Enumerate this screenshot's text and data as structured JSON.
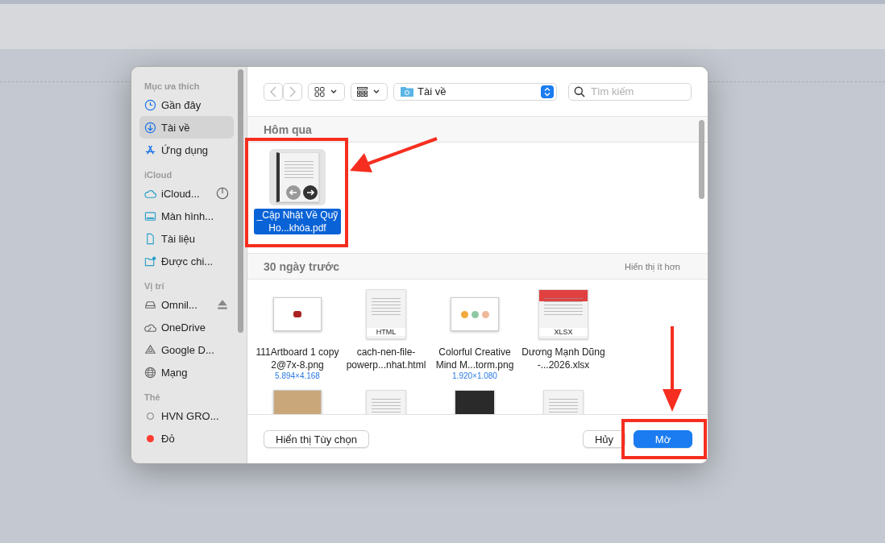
{
  "sidebar": {
    "sections": [
      {
        "title": "Mục ưa thích",
        "items": [
          {
            "kind": "recent",
            "label": "Gần đây",
            "selected": false
          },
          {
            "kind": "downloads",
            "label": "Tài về",
            "selected": true
          },
          {
            "kind": "apps",
            "label": "Ứng dụng",
            "selected": false
          }
        ]
      },
      {
        "title": "iCloud",
        "items": [
          {
            "kind": "icloud",
            "label": "iCloud...",
            "selected": false,
            "syncing": true
          },
          {
            "kind": "desktop",
            "label": "Màn hình...",
            "selected": false
          },
          {
            "kind": "document",
            "label": "Tài liệu",
            "selected": false
          },
          {
            "kind": "shared",
            "label": "Được chi...",
            "selected": false
          }
        ]
      },
      {
        "title": "Vị trí",
        "items": [
          {
            "kind": "drive",
            "label": "Omnil...",
            "selected": false,
            "ejectable": true
          },
          {
            "kind": "onedrive",
            "label": "OneDrive",
            "selected": false
          },
          {
            "kind": "gdrive",
            "label": "Google D...",
            "selected": false
          },
          {
            "kind": "network",
            "label": "Mạng",
            "selected": false
          }
        ]
      },
      {
        "title": "Thẻ",
        "items": [
          {
            "kind": "tag",
            "label": "HVN GRO...",
            "selected": false
          },
          {
            "kind": "tag",
            "label": "Đỏ",
            "selected": false,
            "color": "#ff3b30"
          }
        ]
      }
    ]
  },
  "toolbar": {
    "back_disabled": true,
    "forward_disabled": true,
    "location": "Tài về",
    "search": {
      "placeholder": "Tìm kiếm"
    }
  },
  "groups": [
    {
      "title": "Hôm qua",
      "files": [
        {
          "kind": "pdf",
          "name": "_Cập Nhật Về Quỹ Ho...khóa.pdf",
          "selected": true
        }
      ]
    },
    {
      "title": "30 ngày trước",
      "action": "Hiển thị ít hơn",
      "files": [
        {
          "kind": "image",
          "name": "111Artboard 1 copy 2@7x-8.png",
          "dimensions": "5.894×4.168",
          "selected": false
        },
        {
          "kind": "html",
          "preview_label": "HTML",
          "name": "cach-nen-file-powerp...nhat.html",
          "selected": false
        },
        {
          "kind": "mindmap",
          "name": "Colorful Creative Mind M...torm.png",
          "dimensions": "1.920×1.080",
          "selected": false
        },
        {
          "kind": "xlsx",
          "preview_label": "XLSX",
          "name": "Dương Mạnh Dũng -...2026.xlsx",
          "selected": false
        }
      ],
      "partial": [
        {
          "kind": "image"
        },
        {
          "kind": "document"
        },
        {
          "kind": "dark"
        },
        {
          "kind": "document"
        }
      ]
    }
  ],
  "footer": {
    "options": "Hiển thị Tùy chọn",
    "cancel": "Hủy",
    "open": "Mờ"
  }
}
